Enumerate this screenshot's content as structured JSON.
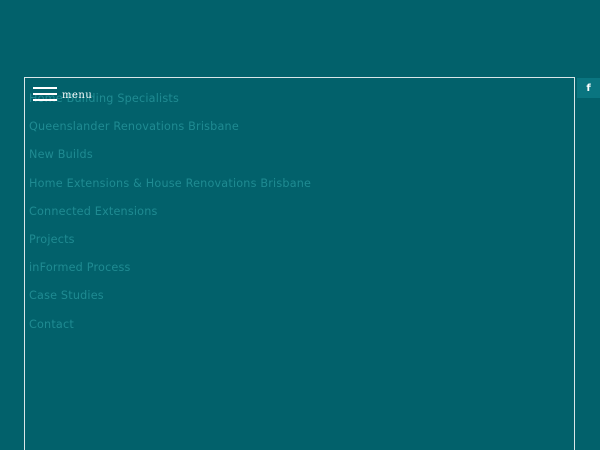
{
  "menu": {
    "label": "menu"
  },
  "nav": {
    "items": [
      {
        "label": "Home Building Specialists"
      },
      {
        "label": "Queenslander Renovations Brisbane"
      },
      {
        "label": "New Builds"
      },
      {
        "label": "Home Extensions & House Renovations Brisbane"
      },
      {
        "label": "Connected Extensions"
      },
      {
        "label": "Projects"
      },
      {
        "label": "inFormed Process"
      },
      {
        "label": "Case Studies"
      },
      {
        "label": "Contact"
      }
    ]
  },
  "social": {
    "facebook_glyph": "f",
    "icon": "facebook-icon"
  },
  "colors": {
    "background": "#02616b",
    "link": "#1f8b92",
    "border": "#d9e6e8",
    "social_bg": "#0a7580"
  }
}
